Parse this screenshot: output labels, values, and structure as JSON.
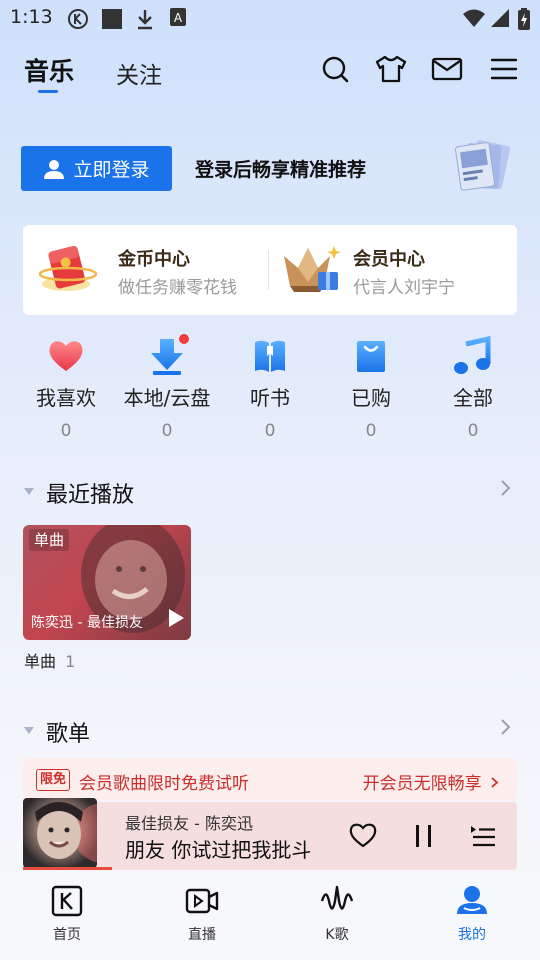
{
  "status_bar": {
    "time": "1:13",
    "icons": [
      "k-app-icon",
      "square-icon",
      "download-icon",
      "translate-icon",
      "wifi-icon",
      "signal-icon",
      "battery-icon"
    ]
  },
  "header": {
    "tabs": [
      {
        "label": "音乐",
        "active": true
      },
      {
        "label": "关注",
        "active": false
      }
    ],
    "actions": [
      "search-icon",
      "tshirt-icon",
      "mail-icon",
      "menu-icon"
    ],
    "accent": "#1a73e8"
  },
  "login": {
    "button_label": "立即登录",
    "hint": "登录后畅享精准推荐",
    "button_color": "#1a73e8"
  },
  "cards": [
    {
      "title": "金币中心",
      "subtitle": "做任务赚零花钱",
      "icon": "gold-coin-envelope-icon"
    },
    {
      "title": "会员中心",
      "subtitle": "代言人刘宇宁",
      "icon": "vip-crown-gift-icon"
    }
  ],
  "quick_entries": [
    {
      "label": "我喜欢",
      "count": "0",
      "icon": "heart-icon"
    },
    {
      "label": "本地/云盘",
      "count": "0",
      "icon": "download-arrow-icon"
    },
    {
      "label": "听书",
      "count": "0",
      "icon": "book-icon"
    },
    {
      "label": "已购",
      "count": "0",
      "icon": "shopping-bag-icon"
    },
    {
      "label": "全部",
      "count": "0",
      "icon": "music-note-icon"
    }
  ],
  "recent": {
    "title": "最近播放",
    "card": {
      "badge": "单曲",
      "name": "陈奕迅 - 最佳损友"
    },
    "caption_label": "单曲",
    "caption_count": "1"
  },
  "playlists": {
    "title": "歌单",
    "banner": {
      "tag": "限免",
      "text": "会员歌曲限时免费试听",
      "link": "开会员无限畅享"
    }
  },
  "player": {
    "song": "最佳损友 - 陈奕迅",
    "lyric": "朋友 你试过把我批斗",
    "progress": 0.18,
    "progress_color": "#e74c3c"
  },
  "bottom_nav": [
    {
      "label": "首页",
      "icon": "k-home-icon",
      "active": false
    },
    {
      "label": "直播",
      "icon": "live-video-icon",
      "active": false
    },
    {
      "label": "K歌",
      "icon": "k-song-wave-icon",
      "active": false
    },
    {
      "label": "我的",
      "icon": "profile-icon",
      "active": true
    }
  ]
}
